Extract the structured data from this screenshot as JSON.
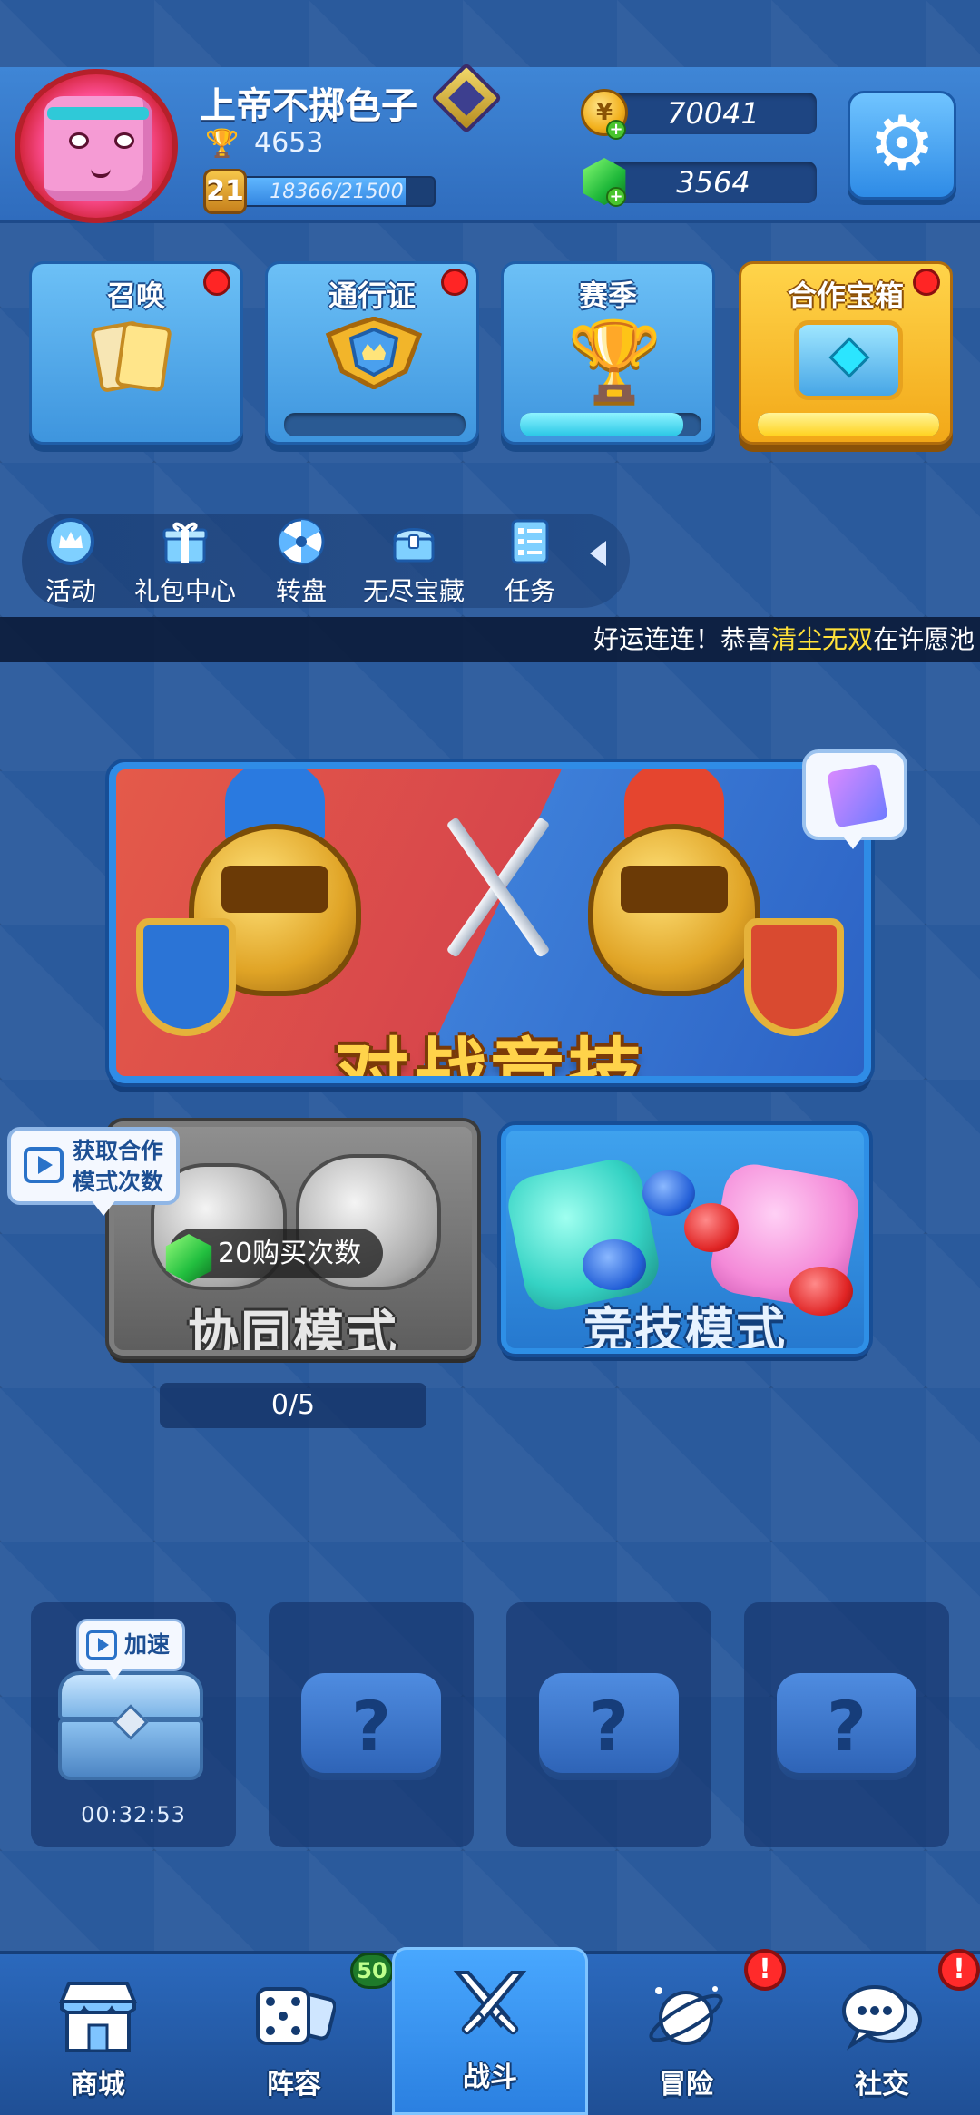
{
  "profile": {
    "username": "上帝不掷色子",
    "trophies": "4653",
    "level": "21",
    "xp_text": "18366/21500",
    "xp_progress": 0.854
  },
  "currency": {
    "gold": "70041",
    "gems": "3564"
  },
  "icons": {
    "settings": "gear-icon",
    "trophy": "trophy-icon",
    "gold": "gold-coin-icon",
    "gem": "gem-icon"
  },
  "feature_cards": [
    {
      "label": "召唤",
      "has_alert": true,
      "bar_progress": null
    },
    {
      "label": "通行证",
      "has_alert": true,
      "bar_progress": 0.0
    },
    {
      "label": "赛季",
      "has_alert": false,
      "bar_progress": 0.9
    },
    {
      "label": "合作宝箱",
      "has_alert": true,
      "bar_progress": 1.0
    }
  ],
  "shortcuts": [
    "活动",
    "礼包中心",
    "转盘",
    "无尽宝藏",
    "任务"
  ],
  "ticker": {
    "prefix": "好运连连！恭喜",
    "highlight": "清尘无双",
    "suffix": "在许愿池"
  },
  "modes": {
    "pvp_title": "对战竞技",
    "coop_title": "协同模式",
    "coop_buy_label": "20购买次数",
    "coop_video_tip": "获取合作模式次数",
    "coop_counter": "0/5",
    "compete_title": "竞技模式"
  },
  "chest_slots": {
    "speedup_label": "加速",
    "timer": "00:32:53",
    "empty_symbol": "?"
  },
  "bottom_nav": {
    "items": [
      "商城",
      "阵容",
      "战斗",
      "冒险",
      "社交"
    ],
    "active": "战斗",
    "lineup_count": "50",
    "alert_symbol": "!"
  },
  "colors": {
    "background": "#2a5a9c",
    "accent_blue": "#2f8ce6",
    "gold": "#ffd44a",
    "alert_red": "#ff2525",
    "highlight_yellow": "#ffe13a"
  }
}
